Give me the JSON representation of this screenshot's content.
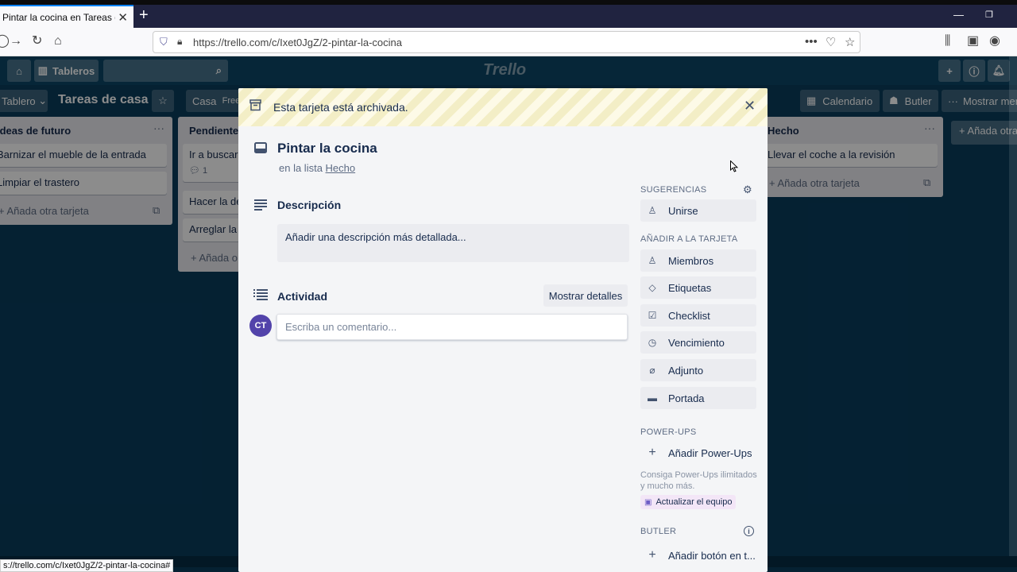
{
  "browser": {
    "tab_title": "Pintar la cocina en Tareas de ca",
    "url": "https://trello.com/c/Ixet0JgZ/2-pintar-la-cocina",
    "status_url": "s://trello.com/c/Ixet0JgZ/2-pintar-la-cocina#"
  },
  "header": {
    "boards_label": "Tableros",
    "logo_text": "Trello"
  },
  "board": {
    "view_label": "Tablero",
    "title": "Tareas de casa",
    "team_label": "Casa",
    "team_badge": "Free",
    "calendar_label": "Calendario",
    "butler_label": "Butler",
    "show_menu_label": "Mostrar menú"
  },
  "lists": {
    "ideas": {
      "title": "Ideas de futuro",
      "cards": [
        "Barnizar el mueble de la entrada",
        "Limpiar el trastero"
      ],
      "add_card": "Añada otra tarjeta"
    },
    "pending": {
      "title": "Pendientes",
      "cards": [
        "Ir a buscar l",
        "Hacer la de",
        "Arreglar la i"
      ],
      "comment_count": "1",
      "add_card": "Añada o"
    },
    "done": {
      "title": "Hecho",
      "cards": [
        "Llevar el coche a la revisión"
      ],
      "add_card": "Añada otra tarjeta"
    },
    "add_list": "Añada otra"
  },
  "modal": {
    "archived_text": "Esta tarjeta está archivada.",
    "card_title": "Pintar la cocina",
    "in_list_prefix": "en la lista",
    "in_list_name": "Hecho",
    "description_title": "Descripción",
    "description_placeholder": "Añadir una descripción más detallada...",
    "activity_title": "Actividad",
    "show_details": "Mostrar detalles",
    "avatar_initials": "CT",
    "comment_placeholder": "Escriba un comentario..."
  },
  "sidebar": {
    "suggestions_heading": "SUGERENCIAS",
    "join": "Unirse",
    "add_to_card_heading": "AÑADIR A LA TARJETA",
    "members": "Miembros",
    "labels": "Etiquetas",
    "checklist": "Checklist",
    "due": "Vencimiento",
    "attachment": "Adjunto",
    "cover": "Portada",
    "powerups_heading": "POWER-UPS",
    "add_powerups": "Añadir Power-Ups",
    "powerups_desc": "Consiga Power-Ups ilimitados y mucho más.",
    "upgrade_team": "Actualizar el equipo",
    "butler_heading": "BUTLER",
    "add_button": "Añadir botón en t..."
  }
}
